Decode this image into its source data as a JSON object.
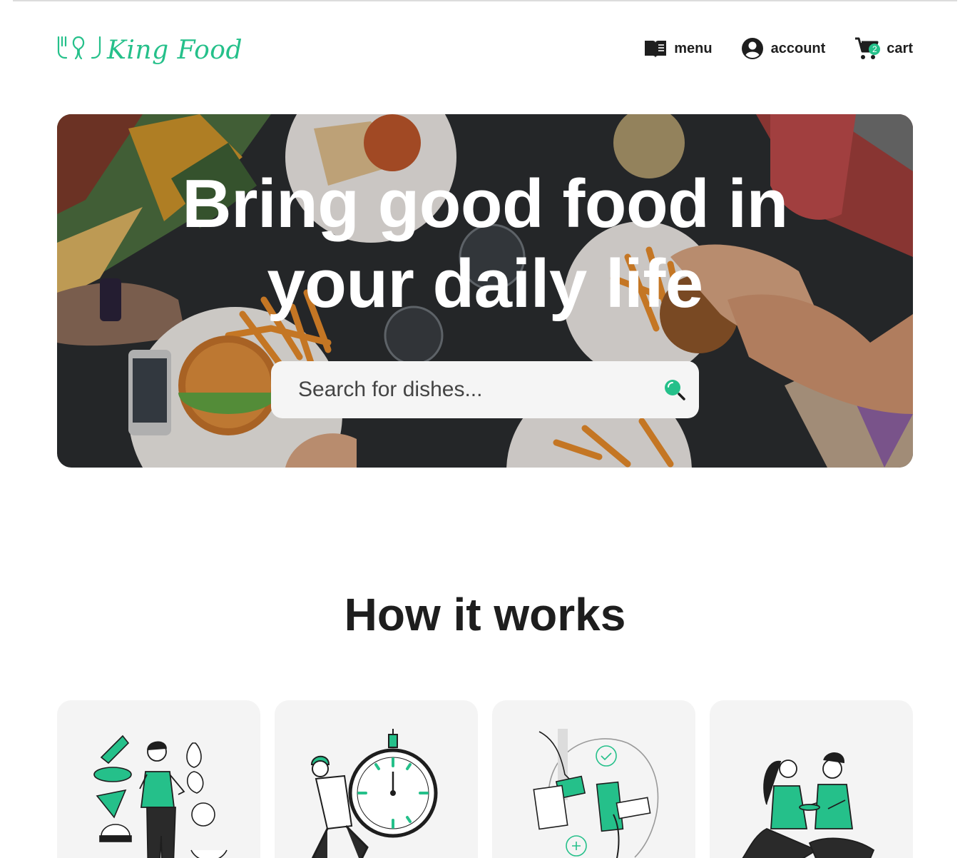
{
  "brand": {
    "name": "King Food",
    "accent_color": "#25c08a"
  },
  "nav": {
    "menu_label": "menu",
    "account_label": "account",
    "cart_label": "cart",
    "cart_count": "2"
  },
  "hero": {
    "title": "Bring good food in your daily life",
    "search_placeholder": "Search for dishes..."
  },
  "how_it_works": {
    "title": "How it works",
    "cards": [
      {
        "illustration": "choose-food-illustration"
      },
      {
        "illustration": "fast-delivery-illustration"
      },
      {
        "illustration": "payment-illustration"
      },
      {
        "illustration": "enjoy-meal-illustration"
      }
    ]
  },
  "icons": [
    "menu-book-icon",
    "account-circle-icon",
    "cart-icon",
    "search-icon",
    "logo-icon"
  ]
}
